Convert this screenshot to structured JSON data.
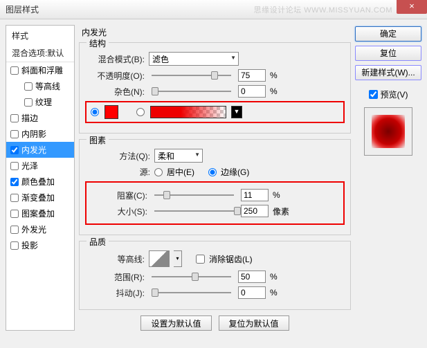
{
  "title": "图层样式",
  "watermark": "思缘设计论坛 WWW.MISSYUAN.COM",
  "close": "×",
  "sidebar": {
    "header": "样式",
    "blend_default": "混合选项:默认",
    "items": [
      {
        "label": "斜面和浮雕",
        "checked": false
      },
      {
        "label": "等高线",
        "checked": false,
        "indent": true
      },
      {
        "label": "纹理",
        "checked": false,
        "indent": true
      },
      {
        "label": "描边",
        "checked": false
      },
      {
        "label": "内阴影",
        "checked": false
      },
      {
        "label": "内发光",
        "checked": true,
        "selected": true
      },
      {
        "label": "光泽",
        "checked": false
      },
      {
        "label": "颜色叠加",
        "checked": true
      },
      {
        "label": "渐变叠加",
        "checked": false
      },
      {
        "label": "图案叠加",
        "checked": false
      },
      {
        "label": "外发光",
        "checked": false
      },
      {
        "label": "投影",
        "checked": false
      }
    ]
  },
  "panel_title": "内发光",
  "groups": {
    "structure": {
      "legend": "结构",
      "blend_mode_label": "混合模式(B):",
      "blend_mode_value": "滤色",
      "opacity_label": "不透明度(O):",
      "opacity_value": "75",
      "noise_label": "杂色(N):",
      "noise_value": "0",
      "percent": "%"
    },
    "elements": {
      "legend": "图素",
      "method_label": "方法(Q):",
      "method_value": "柔和",
      "source_label": "源:",
      "center_label": "居中(E)",
      "edge_label": "边缘(G)",
      "choke_label": "阻塞(C):",
      "choke_value": "11",
      "size_label": "大小(S):",
      "size_value": "250",
      "percent": "%",
      "px": "像素"
    },
    "quality": {
      "legend": "品质",
      "contour_label": "等高线:",
      "antialias_label": "消除锯齿(L)",
      "range_label": "范围(R):",
      "range_value": "50",
      "jitter_label": "抖动(J):",
      "jitter_value": "0",
      "percent": "%"
    }
  },
  "bottom": {
    "make_default": "设置为默认值",
    "reset_default": "复位为默认值"
  },
  "right": {
    "ok": "确定",
    "reset": "复位",
    "new_style": "新建样式(W)...",
    "preview": "预览(V)"
  }
}
